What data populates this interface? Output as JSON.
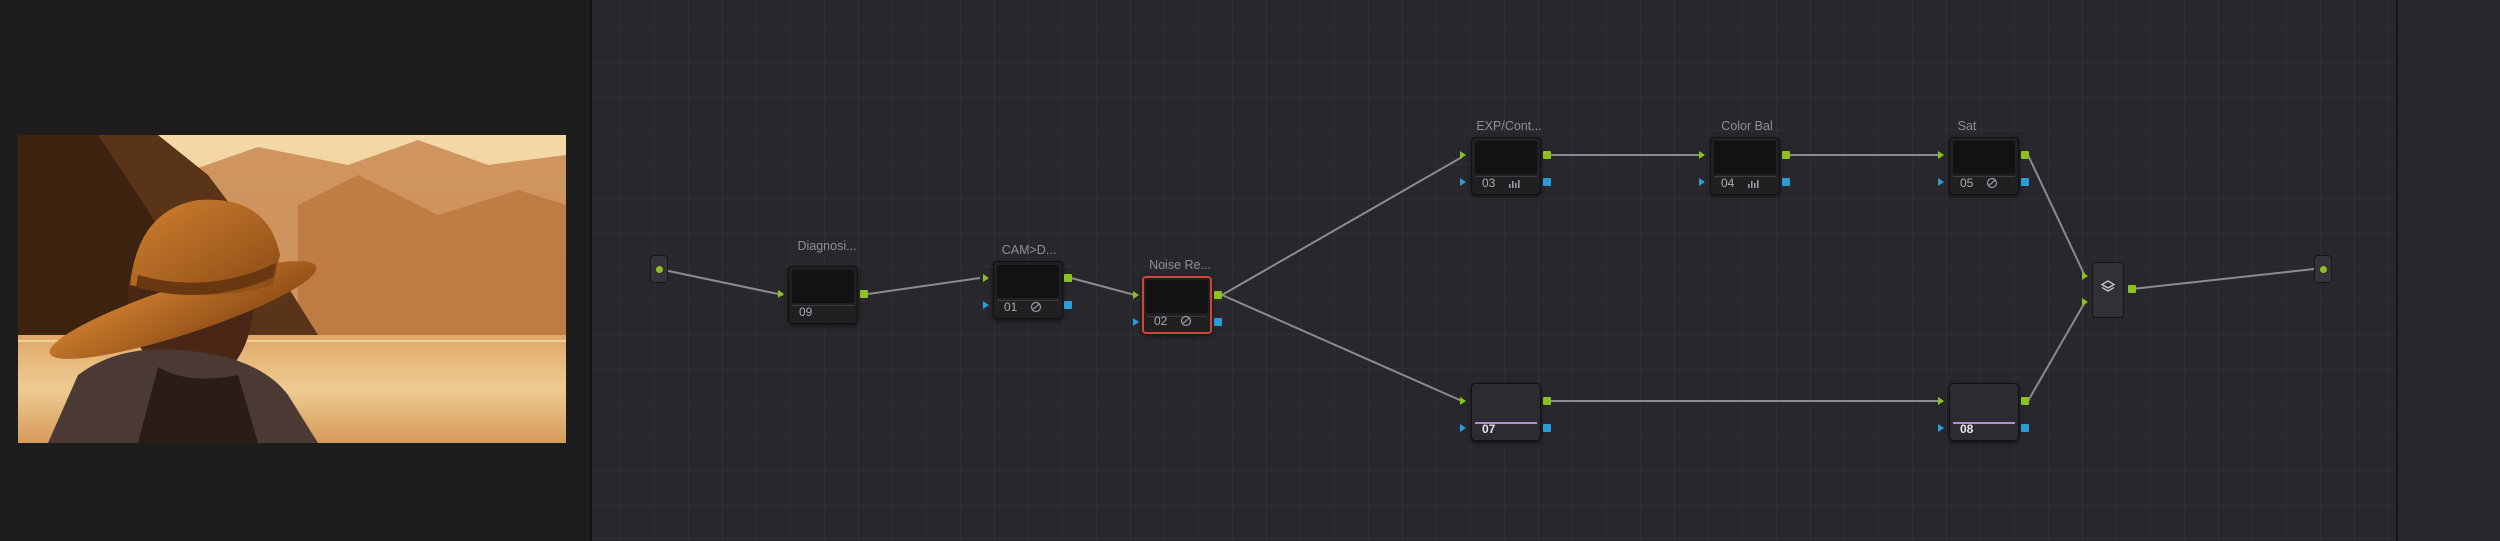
{
  "viewer": {
    "image_alt": "person in a wide-brimmed hat looking at a lake and mountains, warm orange grade"
  },
  "node_graph": {
    "nodes": {
      "n09": {
        "label": "Diagnosi...",
        "number": "09",
        "tool_icon": ""
      },
      "n01": {
        "label": "CAM>D...",
        "number": "01",
        "tool_icon": "color-wheel-icon"
      },
      "n02": {
        "label": "Noise Re...",
        "number": "02",
        "tool_icon": "color-wheel-icon",
        "selected": true
      },
      "n03": {
        "label": "EXP/Cont...",
        "number": "03",
        "tool_icon": "curves-icon"
      },
      "n04": {
        "label": "Color Bal",
        "number": "04",
        "tool_icon": "curves-icon"
      },
      "n05": {
        "label": "Sat",
        "number": "05",
        "tool_icon": "color-wheel-icon"
      },
      "n07": {
        "label": "",
        "number": "07",
        "tool_icon": ""
      },
      "n08": {
        "label": "",
        "number": "08",
        "tool_icon": ""
      }
    },
    "layer_mixer": {
      "icon": "layers-icon"
    }
  },
  "colors": {
    "rgb_port": "#8bc21f",
    "alpha_port": "#2b9cdb",
    "selected_border": "#d2443c",
    "wire": "#8a8a90",
    "graph_bg": "#28282c"
  }
}
